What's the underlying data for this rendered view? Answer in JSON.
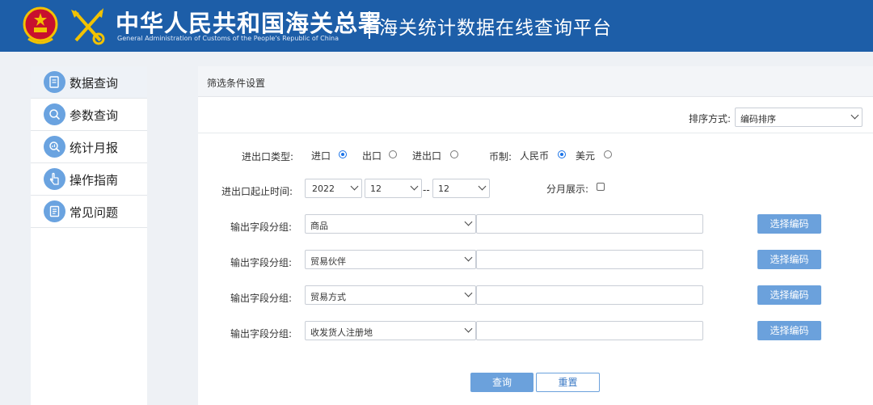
{
  "header": {
    "org_name_cn": "中华人民共和国海关总署",
    "org_name_en": "General Administration of Customs of the People's Republic of China",
    "platform_title": "海关统计数据在线查询平台"
  },
  "sidebar": {
    "items": [
      {
        "label": "数据查询",
        "icon": "data-query-icon"
      },
      {
        "label": "参数查询",
        "icon": "param-query-icon"
      },
      {
        "label": "统计月报",
        "icon": "monthly-report-icon"
      },
      {
        "label": "操作指南",
        "icon": "guide-icon"
      },
      {
        "label": "常见问题",
        "icon": "faq-icon"
      }
    ]
  },
  "panel": {
    "title": "筛选条件设置",
    "sort_label": "排序方式:",
    "sort_value": "编码排序"
  },
  "filters": {
    "trade_type_label": "进出口类型:",
    "trade_options": [
      "进口",
      "出口",
      "进出口"
    ],
    "trade_selected": "进口",
    "currency_label": "币制:",
    "currency_options": [
      "人民币",
      "美元"
    ],
    "currency_selected": "人民币",
    "period_label": "进出口起止时间:",
    "year": "2022",
    "month_start": "12",
    "range_sep": "--",
    "month_end": "12",
    "monthly_label": "分月展示:",
    "monthly_checked": false,
    "group_label": "输出字段分组:",
    "groups": [
      {
        "value": "商品",
        "code": ""
      },
      {
        "value": "贸易伙伴",
        "code": ""
      },
      {
        "value": "贸易方式",
        "code": ""
      },
      {
        "value": "收发货人注册地",
        "code": ""
      }
    ],
    "select_code_label": "选择编码"
  },
  "actions": {
    "query_label": "查询",
    "reset_label": "重置"
  },
  "colors": {
    "header_bg": "#1d5ea8",
    "accent": "#6ba1dc",
    "radio_checked": "#1a73e8"
  }
}
